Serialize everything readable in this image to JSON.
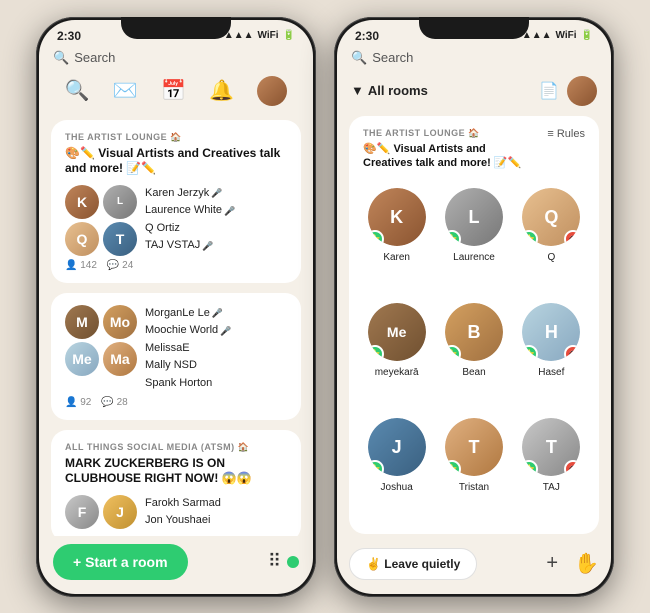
{
  "left_phone": {
    "status_time": "2:30",
    "search_label": "Search",
    "rooms": [
      {
        "tag": "THE ARTIST LOUNGE 🏠",
        "title": "🎨✏️ Visual Artists and Creatives talk and more! 📝✏️",
        "speakers": [
          "Karen Jerzyk",
          "Laurence White",
          "Q Ortiz",
          "TAJ VSTAJ"
        ],
        "listeners": "142",
        "comments": "24"
      },
      {
        "tag": "",
        "title": "",
        "speakers": [
          "MorganLe Le",
          "Moochie World",
          "MelissaE",
          "Mally NSD",
          "Spank Horton"
        ],
        "listeners": "92",
        "comments": "28"
      },
      {
        "tag": "ALL THINGS SOCIAL MEDIA (ATSM) 🏠",
        "title": "MARK ZUCKERBERG IS ON CLUBHOUSE RIGHT NOW! 😱😱",
        "speakers": [
          "Farokh Sarmad",
          "Jon Youshaei"
        ],
        "listeners": "",
        "comments": ""
      }
    ],
    "start_room_label": "+ Start a room"
  },
  "right_phone": {
    "status_time": "2:30",
    "search_label": "Search",
    "all_rooms_label": "All rooms",
    "room": {
      "tag": "THE ARTIST LOUNGE 🏠",
      "title": "🎨✏️ Visual Artists and\nCreatives talk and more! 📝✏️",
      "rules_label": "≡ Rules",
      "speakers": [
        {
          "name": "Karen",
          "muted": false
        },
        {
          "name": "Laurence",
          "muted": false
        },
        {
          "name": "Q",
          "muted": true
        },
        {
          "name": "meyekarā",
          "muted": false
        },
        {
          "name": "Bean",
          "muted": false
        },
        {
          "name": "Hasef",
          "muted": true
        },
        {
          "name": "Joshua",
          "muted": false
        },
        {
          "name": "Tristan",
          "muted": false
        },
        {
          "name": "TAJ",
          "muted": true
        }
      ]
    },
    "leave_quietly_label": "✌️ Leave quietly",
    "add_icon": "+",
    "hand_icon": "✋"
  }
}
